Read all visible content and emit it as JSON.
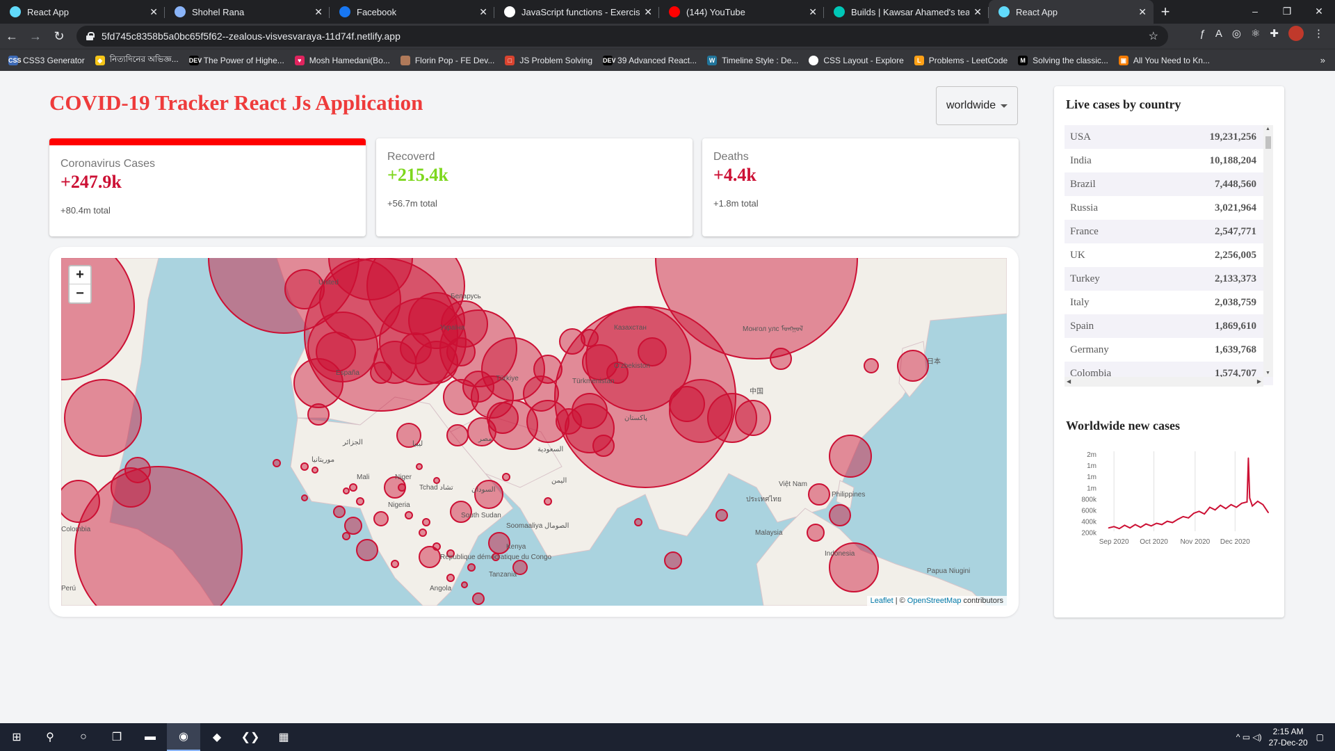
{
  "browser": {
    "tabs": [
      {
        "label": "React App",
        "icon": "react-icon",
        "color": "#61dafb"
      },
      {
        "label": "Shohel Rana",
        "icon": "profile-icon",
        "color": "#8ab4f8"
      },
      {
        "label": "Facebook",
        "icon": "facebook-icon",
        "color": "#1877f2"
      },
      {
        "label": "JavaScript functions - Exercises, P",
        "icon": "w3r-icon",
        "color": "#ffffff"
      },
      {
        "label": "(144) YouTube",
        "icon": "youtube-icon",
        "color": "#ff0000"
      },
      {
        "label": "Builds | Kawsar Ahamed's team",
        "icon": "netlify-icon",
        "color": "#00c7b7"
      },
      {
        "label": "React App",
        "icon": "react-icon",
        "color": "#61dafb"
      }
    ],
    "active_tab": 6,
    "new_tab": "+",
    "window_controls": {
      "minimize": "–",
      "maximize": "❐",
      "close": "✕"
    },
    "url": "5fd745c8358b5a0bc65f5f62--zealous-visvesvaraya-11d74f.netlify.app",
    "bookmarks": [
      {
        "label": "CSS3 Generator",
        "icon": "css3-icon",
        "color": "#3d6ab6",
        "glyph": "CSS"
      },
      {
        "label": "নিত্যদিনের অভিজ্ঞ...",
        "icon": "hexagon-icon",
        "color": "#f5c518",
        "glyph": "◆"
      },
      {
        "label": "The Power of Highe...",
        "icon": "dev-icon",
        "color": "#000000",
        "glyph": "DEV"
      },
      {
        "label": "Mosh Hamedani(Bo...",
        "icon": "heart-icon",
        "color": "#e0245e",
        "glyph": "♥"
      },
      {
        "label": "Florin Pop - FE Dev...",
        "icon": "avatar-icon",
        "color": "#b07a5a",
        "glyph": ""
      },
      {
        "label": "JS Problem Solving",
        "icon": "js-icon",
        "color": "#d9432f",
        "glyph": "□"
      },
      {
        "label": "39 Advanced React...",
        "icon": "dev-icon",
        "color": "#000000",
        "glyph": "DEV"
      },
      {
        "label": "Timeline Style : De...",
        "icon": "wordpress-icon",
        "color": "#21759b",
        "glyph": "W"
      },
      {
        "label": "CSS Layout - Explore",
        "icon": "github-icon",
        "color": "#ffffff",
        "glyph": ""
      },
      {
        "label": "Problems - LeetCode",
        "icon": "leetcode-icon",
        "color": "#ffa116",
        "glyph": "L"
      },
      {
        "label": "Solving the classic...",
        "icon": "medium-icon",
        "color": "#000000",
        "glyph": "M"
      },
      {
        "label": "All You Need to Kn...",
        "icon": "orange-icon",
        "color": "#f57c00",
        "glyph": "▣"
      }
    ],
    "bookmarks_more": "»"
  },
  "app": {
    "title": "COVID-19 Tracker React Js Application",
    "country_select": {
      "value": "worldwide"
    },
    "stats": [
      {
        "title": "Coronavirus Cases",
        "value": "+247.9k",
        "total": "+80.4m total",
        "selected": true,
        "color": "#cc1034"
      },
      {
        "title": "Recoverd",
        "value": "+215.4k",
        "total": "+56.7m total",
        "selected": false,
        "color": "#7dd71d"
      },
      {
        "title": "Deaths",
        "value": "+4.4k",
        "total": "+1.8m total",
        "selected": false,
        "color": "#cc1034"
      }
    ],
    "map": {
      "zoom_in": "+",
      "zoom_out": "−",
      "attribution": {
        "leaflet": "Leaflet",
        "separator": "| ©",
        "osm": "OpenStreetMap",
        "suffix": "contributors"
      },
      "labels": [
        "United",
        "Беларусь",
        "Україна",
        "España",
        "Türkiye",
        "Казахстан",
        "Монгол улс ᠮᠣᠩᠭᠣᠯ",
        "O'zbekiston",
        "Türkmenistan",
        "پاکستان",
        "中国",
        "日本",
        "Mali",
        "Niger",
        "Tchad تشاد",
        "السودان",
        "Nigeria",
        "South Sudan",
        "Soomaaliya الصومال",
        "République démocratique du Congo",
        "Kenya",
        "Tanzania",
        "Angola",
        "مصر",
        "السعودية",
        "Việt Nam",
        "Philippines",
        "Malaysia",
        "Indonesia",
        "Papua Niugini",
        "Colombia",
        "Perú",
        "موريتانيا",
        "الجزائر",
        "ليبيا",
        "اليمن",
        "ประเทศไทย"
      ],
      "marker_color": "#cc1034"
    },
    "sidebar": {
      "title": "Live cases by country",
      "countries": [
        {
          "name": "USA",
          "cases": "19,231,256"
        },
        {
          "name": "India",
          "cases": "10,188,204"
        },
        {
          "name": "Brazil",
          "cases": "7,448,560"
        },
        {
          "name": "Russia",
          "cases": "3,021,964"
        },
        {
          "name": "France",
          "cases": "2,547,771"
        },
        {
          "name": "UK",
          "cases": "2,256,005"
        },
        {
          "name": "Turkey",
          "cases": "2,133,373"
        },
        {
          "name": "Italy",
          "cases": "2,038,759"
        },
        {
          "name": "Spain",
          "cases": "1,869,610"
        },
        {
          "name": "Germany",
          "cases": "1,639,768"
        },
        {
          "name": "Colombia",
          "cases": "1,574,707"
        }
      ],
      "chart_title": "Worldwide new cases"
    }
  },
  "chart_data": {
    "type": "line",
    "title": "Worldwide new cases",
    "xlabel": "",
    "ylabel": "",
    "x_ticks": [
      "Sep 2020",
      "Oct 2020",
      "Nov 2020",
      "Dec 2020"
    ],
    "y_ticks": [
      "2m",
      "1m",
      "1m",
      "1m",
      "800k",
      "600k",
      "400k",
      "200k"
    ],
    "x": [
      "2020-08-28",
      "2020-09-01",
      "2020-09-05",
      "2020-09-09",
      "2020-09-13",
      "2020-09-17",
      "2020-09-21",
      "2020-09-25",
      "2020-09-29",
      "2020-10-03",
      "2020-10-07",
      "2020-10-11",
      "2020-10-15",
      "2020-10-19",
      "2020-10-23",
      "2020-10-27",
      "2020-10-31",
      "2020-11-04",
      "2020-11-08",
      "2020-11-12",
      "2020-11-16",
      "2020-11-20",
      "2020-11-24",
      "2020-11-28",
      "2020-12-02",
      "2020-12-06",
      "2020-12-10",
      "2020-12-11",
      "2020-12-12",
      "2020-12-14",
      "2020-12-18",
      "2020-12-22",
      "2020-12-26"
    ],
    "values": [
      250000,
      270000,
      240000,
      290000,
      250000,
      300000,
      260000,
      310000,
      280000,
      320000,
      300000,
      350000,
      330000,
      380000,
      420000,
      400000,
      470000,
      500000,
      460000,
      560000,
      520000,
      590000,
      540000,
      600000,
      560000,
      620000,
      640000,
      1300000,
      700000,
      580000,
      650000,
      600000,
      480000
    ],
    "ylim": [
      200000,
      1400000
    ],
    "series_color": "#cc1034"
  },
  "taskbar": {
    "icons": [
      {
        "name": "start-icon",
        "glyph": "⊞"
      },
      {
        "name": "search-icon",
        "glyph": "⚲"
      },
      {
        "name": "cortana-icon",
        "glyph": "○"
      },
      {
        "name": "task-view-icon",
        "glyph": "❐"
      },
      {
        "name": "file-explorer-icon",
        "glyph": "▬"
      },
      {
        "name": "chrome-icon",
        "glyph": "◉"
      },
      {
        "name": "git-icon",
        "glyph": "◆"
      },
      {
        "name": "vscode-icon",
        "glyph": "❮❯"
      },
      {
        "name": "app-icon",
        "glyph": "▦"
      }
    ],
    "time": "2:15 AM",
    "date": "27-Dec-20",
    "tray": "^ ▭ ◁)"
  }
}
